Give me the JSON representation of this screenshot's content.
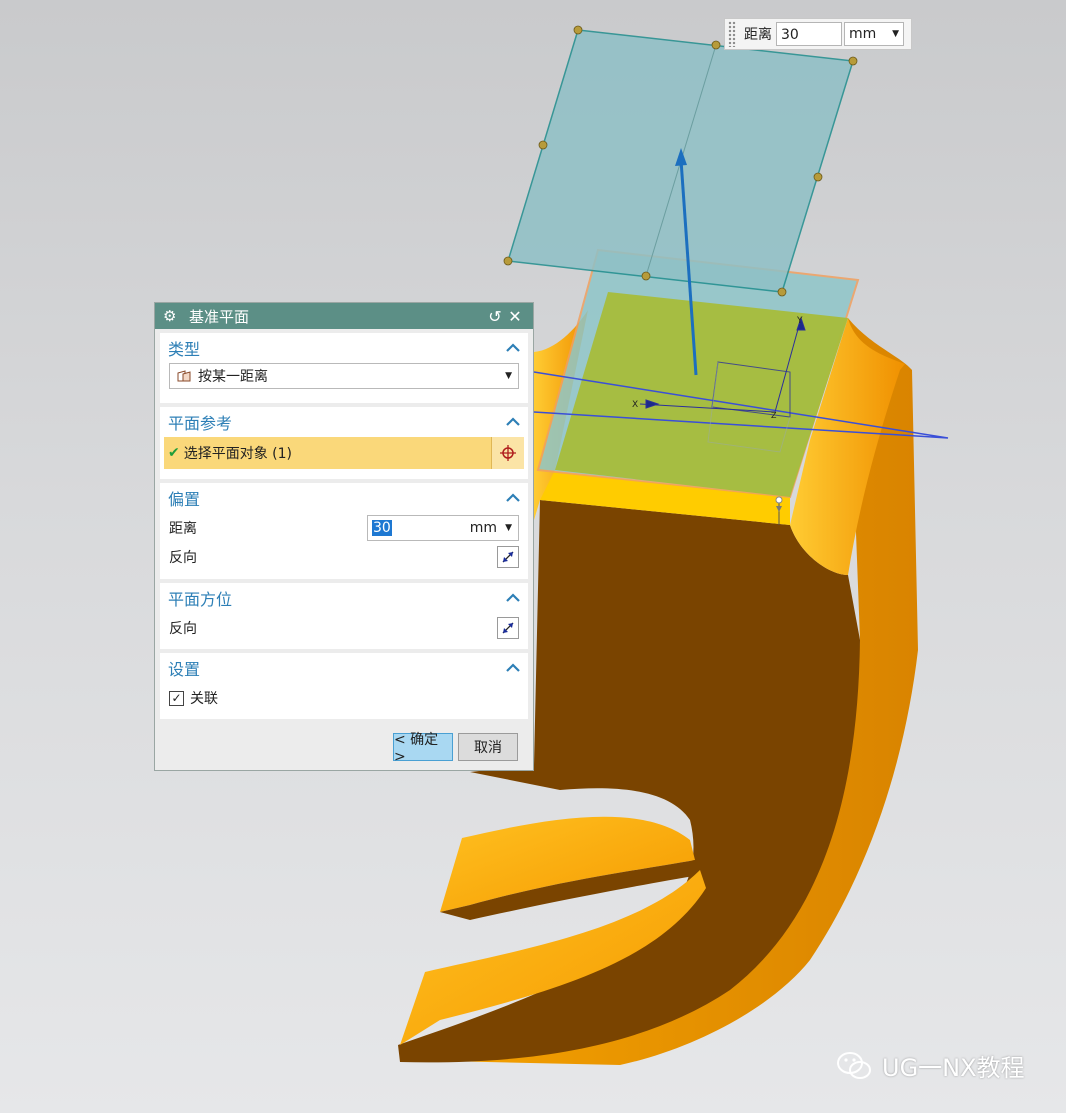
{
  "dim_input": {
    "label": "距离",
    "value": "30",
    "unit": "mm"
  },
  "dialog": {
    "title": "基准平面",
    "sections": {
      "type": {
        "title": "类型",
        "selected": "按某一距离"
      },
      "plane_ref": {
        "title": "平面参考",
        "item": "选择平面对象 (1)"
      },
      "offset": {
        "title": "偏置",
        "distance_label": "距离",
        "distance_value": "30",
        "distance_unit": "mm",
        "reverse_label": "反向"
      },
      "orientation": {
        "title": "平面方位",
        "reverse_label": "反向"
      },
      "settings": {
        "title": "设置",
        "associative_label": "关联",
        "associative_checked": true
      }
    },
    "ok_label": "< 确定 >",
    "cancel_label": "取消"
  },
  "axes": {
    "x": "X",
    "y": "Y",
    "z": "Z"
  },
  "watermark": "UG一NX教程",
  "colors": {
    "title_bar": "#5c8f86",
    "section_title": "#2d7fb6",
    "highlight": "#fad87a",
    "part_orange": "#f5a200",
    "part_brown": "#7a4400",
    "plane": "#8fc0c6",
    "top_face": "#a7bd3a"
  }
}
